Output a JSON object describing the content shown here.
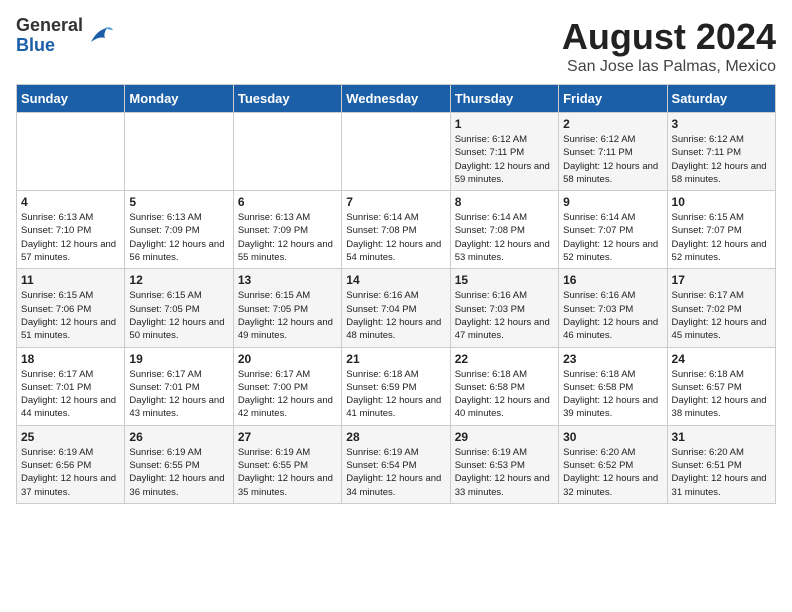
{
  "logo": {
    "general": "General",
    "blue": "Blue"
  },
  "title": "August 2024",
  "subtitle": "San Jose las Palmas, Mexico",
  "days_of_week": [
    "Sunday",
    "Monday",
    "Tuesday",
    "Wednesday",
    "Thursday",
    "Friday",
    "Saturday"
  ],
  "weeks": [
    [
      {
        "day": "",
        "sunrise": "",
        "sunset": "",
        "daylight": ""
      },
      {
        "day": "",
        "sunrise": "",
        "sunset": "",
        "daylight": ""
      },
      {
        "day": "",
        "sunrise": "",
        "sunset": "",
        "daylight": ""
      },
      {
        "day": "",
        "sunrise": "",
        "sunset": "",
        "daylight": ""
      },
      {
        "day": "1",
        "sunrise": "Sunrise: 6:12 AM",
        "sunset": "Sunset: 7:11 PM",
        "daylight": "Daylight: 12 hours and 59 minutes."
      },
      {
        "day": "2",
        "sunrise": "Sunrise: 6:12 AM",
        "sunset": "Sunset: 7:11 PM",
        "daylight": "Daylight: 12 hours and 58 minutes."
      },
      {
        "day": "3",
        "sunrise": "Sunrise: 6:12 AM",
        "sunset": "Sunset: 7:11 PM",
        "daylight": "Daylight: 12 hours and 58 minutes."
      }
    ],
    [
      {
        "day": "4",
        "sunrise": "Sunrise: 6:13 AM",
        "sunset": "Sunset: 7:10 PM",
        "daylight": "Daylight: 12 hours and 57 minutes."
      },
      {
        "day": "5",
        "sunrise": "Sunrise: 6:13 AM",
        "sunset": "Sunset: 7:09 PM",
        "daylight": "Daylight: 12 hours and 56 minutes."
      },
      {
        "day": "6",
        "sunrise": "Sunrise: 6:13 AM",
        "sunset": "Sunset: 7:09 PM",
        "daylight": "Daylight: 12 hours and 55 minutes."
      },
      {
        "day": "7",
        "sunrise": "Sunrise: 6:14 AM",
        "sunset": "Sunset: 7:08 PM",
        "daylight": "Daylight: 12 hours and 54 minutes."
      },
      {
        "day": "8",
        "sunrise": "Sunrise: 6:14 AM",
        "sunset": "Sunset: 7:08 PM",
        "daylight": "Daylight: 12 hours and 53 minutes."
      },
      {
        "day": "9",
        "sunrise": "Sunrise: 6:14 AM",
        "sunset": "Sunset: 7:07 PM",
        "daylight": "Daylight: 12 hours and 52 minutes."
      },
      {
        "day": "10",
        "sunrise": "Sunrise: 6:15 AM",
        "sunset": "Sunset: 7:07 PM",
        "daylight": "Daylight: 12 hours and 52 minutes."
      }
    ],
    [
      {
        "day": "11",
        "sunrise": "Sunrise: 6:15 AM",
        "sunset": "Sunset: 7:06 PM",
        "daylight": "Daylight: 12 hours and 51 minutes."
      },
      {
        "day": "12",
        "sunrise": "Sunrise: 6:15 AM",
        "sunset": "Sunset: 7:05 PM",
        "daylight": "Daylight: 12 hours and 50 minutes."
      },
      {
        "day": "13",
        "sunrise": "Sunrise: 6:15 AM",
        "sunset": "Sunset: 7:05 PM",
        "daylight": "Daylight: 12 hours and 49 minutes."
      },
      {
        "day": "14",
        "sunrise": "Sunrise: 6:16 AM",
        "sunset": "Sunset: 7:04 PM",
        "daylight": "Daylight: 12 hours and 48 minutes."
      },
      {
        "day": "15",
        "sunrise": "Sunrise: 6:16 AM",
        "sunset": "Sunset: 7:03 PM",
        "daylight": "Daylight: 12 hours and 47 minutes."
      },
      {
        "day": "16",
        "sunrise": "Sunrise: 6:16 AM",
        "sunset": "Sunset: 7:03 PM",
        "daylight": "Daylight: 12 hours and 46 minutes."
      },
      {
        "day": "17",
        "sunrise": "Sunrise: 6:17 AM",
        "sunset": "Sunset: 7:02 PM",
        "daylight": "Daylight: 12 hours and 45 minutes."
      }
    ],
    [
      {
        "day": "18",
        "sunrise": "Sunrise: 6:17 AM",
        "sunset": "Sunset: 7:01 PM",
        "daylight": "Daylight: 12 hours and 44 minutes."
      },
      {
        "day": "19",
        "sunrise": "Sunrise: 6:17 AM",
        "sunset": "Sunset: 7:01 PM",
        "daylight": "Daylight: 12 hours and 43 minutes."
      },
      {
        "day": "20",
        "sunrise": "Sunrise: 6:17 AM",
        "sunset": "Sunset: 7:00 PM",
        "daylight": "Daylight: 12 hours and 42 minutes."
      },
      {
        "day": "21",
        "sunrise": "Sunrise: 6:18 AM",
        "sunset": "Sunset: 6:59 PM",
        "daylight": "Daylight: 12 hours and 41 minutes."
      },
      {
        "day": "22",
        "sunrise": "Sunrise: 6:18 AM",
        "sunset": "Sunset: 6:58 PM",
        "daylight": "Daylight: 12 hours and 40 minutes."
      },
      {
        "day": "23",
        "sunrise": "Sunrise: 6:18 AM",
        "sunset": "Sunset: 6:58 PM",
        "daylight": "Daylight: 12 hours and 39 minutes."
      },
      {
        "day": "24",
        "sunrise": "Sunrise: 6:18 AM",
        "sunset": "Sunset: 6:57 PM",
        "daylight": "Daylight: 12 hours and 38 minutes."
      }
    ],
    [
      {
        "day": "25",
        "sunrise": "Sunrise: 6:19 AM",
        "sunset": "Sunset: 6:56 PM",
        "daylight": "Daylight: 12 hours and 37 minutes."
      },
      {
        "day": "26",
        "sunrise": "Sunrise: 6:19 AM",
        "sunset": "Sunset: 6:55 PM",
        "daylight": "Daylight: 12 hours and 36 minutes."
      },
      {
        "day": "27",
        "sunrise": "Sunrise: 6:19 AM",
        "sunset": "Sunset: 6:55 PM",
        "daylight": "Daylight: 12 hours and 35 minutes."
      },
      {
        "day": "28",
        "sunrise": "Sunrise: 6:19 AM",
        "sunset": "Sunset: 6:54 PM",
        "daylight": "Daylight: 12 hours and 34 minutes."
      },
      {
        "day": "29",
        "sunrise": "Sunrise: 6:19 AM",
        "sunset": "Sunset: 6:53 PM",
        "daylight": "Daylight: 12 hours and 33 minutes."
      },
      {
        "day": "30",
        "sunrise": "Sunrise: 6:20 AM",
        "sunset": "Sunset: 6:52 PM",
        "daylight": "Daylight: 12 hours and 32 minutes."
      },
      {
        "day": "31",
        "sunrise": "Sunrise: 6:20 AM",
        "sunset": "Sunset: 6:51 PM",
        "daylight": "Daylight: 12 hours and 31 minutes."
      }
    ]
  ]
}
